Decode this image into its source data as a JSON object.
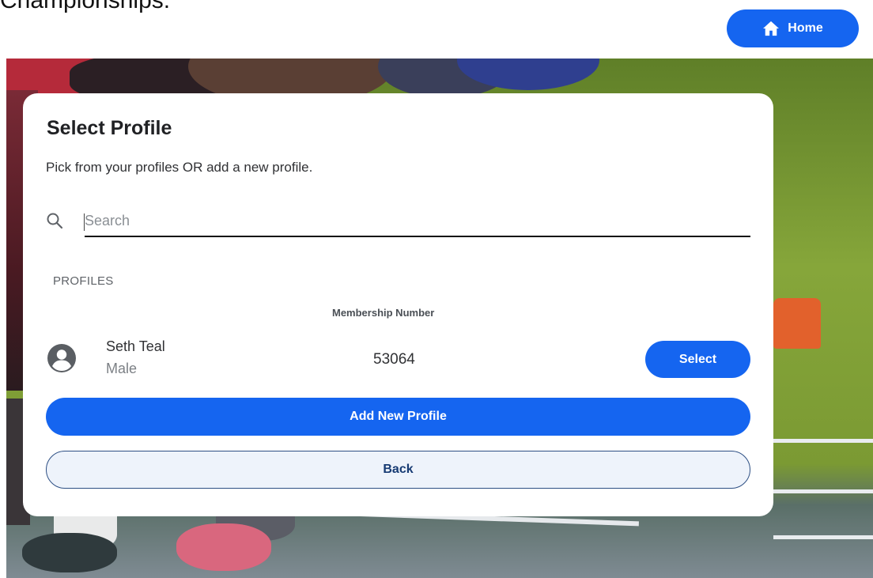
{
  "page": {
    "top_text": "Championships."
  },
  "header": {
    "home_label": "Home"
  },
  "profile_card": {
    "title": "Select Profile",
    "subtitle": "Pick from your profiles OR add a new profile.",
    "search": {
      "placeholder": "Search",
      "value": ""
    },
    "section_label": "PROFILES",
    "column_header": "Membership Number",
    "profiles": [
      {
        "name": "Seth Teal",
        "gender": "Male",
        "membership_number": "53064",
        "action_label": "Select"
      }
    ],
    "add_label": "Add New Profile",
    "back_label": "Back"
  },
  "icons": {
    "home": "home-icon",
    "search": "search-icon",
    "avatar": "account-circle-icon"
  },
  "colors": {
    "primary": "#1565f0",
    "back_bg": "#eef3fb",
    "back_border": "#2d4f84",
    "back_text": "#163a73"
  }
}
